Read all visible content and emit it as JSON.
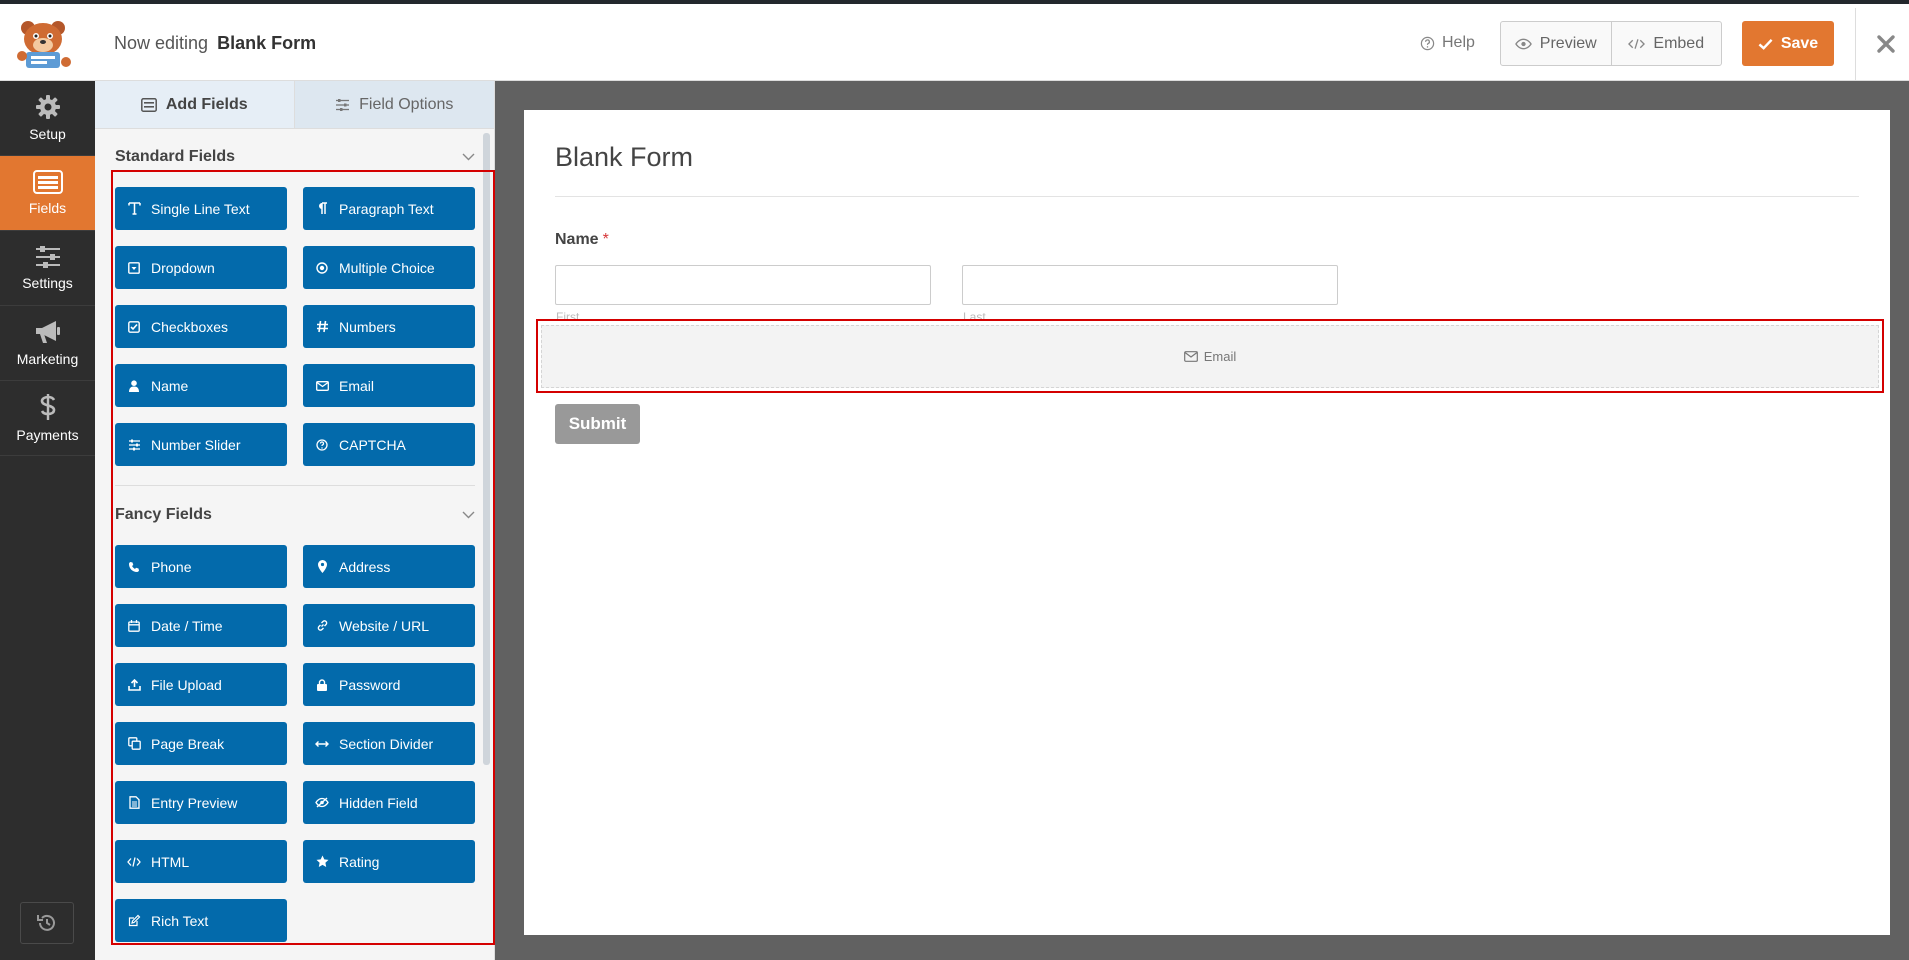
{
  "header": {
    "editing_prefix": "Now editing",
    "form_name": "Blank Form",
    "help_label": "Help",
    "preview_label": "Preview",
    "embed_label": "Embed",
    "save_label": "Save",
    "accent_color": "#e27730"
  },
  "sidebar": {
    "items": [
      {
        "label": "Setup",
        "icon": "gear-icon"
      },
      {
        "label": "Fields",
        "icon": "fields-list-icon",
        "active": true
      },
      {
        "label": "Settings",
        "icon": "sliders-icon"
      },
      {
        "label": "Marketing",
        "icon": "megaphone-icon"
      },
      {
        "label": "Payments",
        "icon": "dollar-icon"
      }
    ],
    "history_icon": "history-icon"
  },
  "panel": {
    "tabs": [
      {
        "label": "Add Fields",
        "icon": "list-icon",
        "active": true
      },
      {
        "label": "Field Options",
        "icon": "sliders-icon"
      }
    ],
    "standard_title": "Standard Fields",
    "fancy_title": "Fancy Fields",
    "button_color": "#036aab",
    "standard_fields": [
      {
        "label": "Single Line Text",
        "icon": "text-icon"
      },
      {
        "label": "Paragraph Text",
        "icon": "paragraph-icon"
      },
      {
        "label": "Dropdown",
        "icon": "dropdown-icon"
      },
      {
        "label": "Multiple Choice",
        "icon": "radio-icon"
      },
      {
        "label": "Checkboxes",
        "icon": "checkbox-icon"
      },
      {
        "label": "Numbers",
        "icon": "hash-icon"
      },
      {
        "label": "Name",
        "icon": "user-icon"
      },
      {
        "label": "Email",
        "icon": "envelope-icon"
      },
      {
        "label": "Number Slider",
        "icon": "sliders-icon"
      },
      {
        "label": "CAPTCHA",
        "icon": "question-icon"
      }
    ],
    "fancy_fields": [
      {
        "label": "Phone",
        "icon": "phone-icon"
      },
      {
        "label": "Address",
        "icon": "map-pin-icon"
      },
      {
        "label": "Date / Time",
        "icon": "calendar-icon"
      },
      {
        "label": "Website / URL",
        "icon": "link-icon"
      },
      {
        "label": "File Upload",
        "icon": "upload-icon"
      },
      {
        "label": "Password",
        "icon": "lock-icon"
      },
      {
        "label": "Page Break",
        "icon": "copy-icon"
      },
      {
        "label": "Section Divider",
        "icon": "arrows-h-icon"
      },
      {
        "label": "Entry Preview",
        "icon": "file-icon"
      },
      {
        "label": "Hidden Field",
        "icon": "eye-slash-icon"
      },
      {
        "label": "HTML",
        "icon": "code-icon"
      },
      {
        "label": "Rating",
        "icon": "star-icon"
      },
      {
        "label": "Rich Text",
        "icon": "edit-icon"
      }
    ]
  },
  "form": {
    "title": "Blank Form",
    "name_label": "Name",
    "required_mark": "*",
    "first_sublabel": "First",
    "last_sublabel": "Last",
    "email_placeholder_label": "Email",
    "submit_label": "Submit"
  }
}
